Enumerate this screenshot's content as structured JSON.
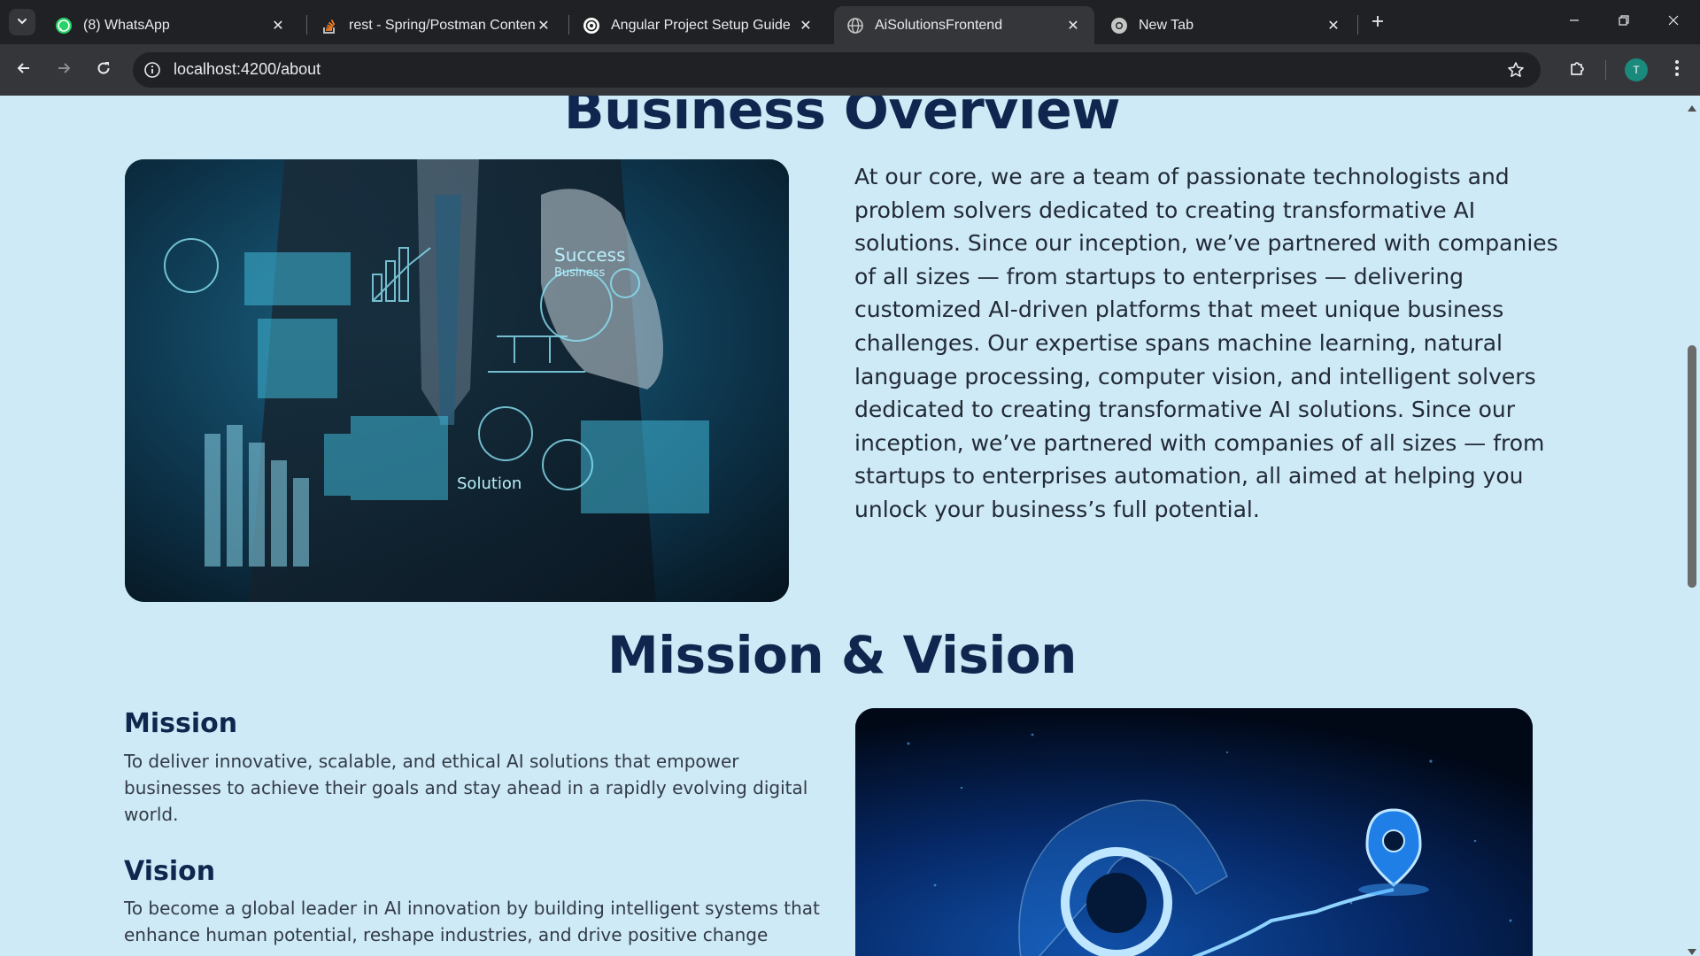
{
  "browser": {
    "tabs": [
      {
        "title": "(8) WhatsApp",
        "icon": "whatsapp-icon",
        "active": false
      },
      {
        "title": "rest - Spring/Postman Content-Type",
        "icon": "stackoverflow-icon",
        "active": false
      },
      {
        "title": "Angular Project Setup Guide",
        "icon": "chatgpt-icon",
        "active": false
      },
      {
        "title": "AiSolutionsFrontend",
        "icon": "globe-icon",
        "active": true
      },
      {
        "title": "New Tab",
        "icon": "chrome-icon",
        "active": false
      }
    ],
    "address": "localhost:4200/about",
    "profile_initial": "T"
  },
  "page": {
    "business_overview": {
      "heading": "Business Overview",
      "image_alt": "businessman touching virtual interface icons",
      "image_labels": {
        "success": "Success",
        "business": "Business",
        "solution": "Solution"
      },
      "paragraph": "At our core, we are a team of passionate technologists and problem solvers dedicated to creating transformative AI solutions. Since our inception, we’ve partnered with companies of all sizes — from startups to enterprises — delivering customized AI-driven platforms that meet unique business challenges. Our expertise spans machine learning, natural language processing, computer vision, and intelligent solvers dedicated to creating transformative AI solutions. Since our inception, we’ve partnered with companies of all sizes — from startups to enterprises automation, all aimed at helping you unlock your business’s full potential."
    },
    "mission_vision": {
      "heading": "Mission & Vision",
      "mission_title": "Mission",
      "mission_text": "To deliver innovative, scalable, and ethical AI solutions that empower businesses to achieve their goals and stay ahead in a rapidly evolving digital world.",
      "vision_title": "Vision",
      "vision_text": "To become a global leader in AI innovation by building intelligent systems that enhance human potential, reshape industries, and drive positive change across"
    }
  },
  "colors": {
    "page_background": "#cdeaf6",
    "heading": "#10264e",
    "body_text": "#222a36",
    "chrome_dark": "#202124",
    "chrome_toolbar": "#35363a"
  }
}
